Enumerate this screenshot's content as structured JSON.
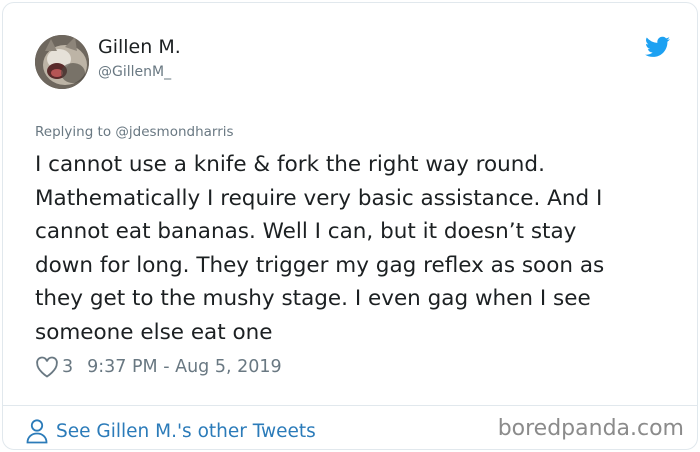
{
  "author": {
    "display_name": "Gillen M.",
    "handle": "@GillenM_",
    "avatar_icon": "cat-avatar"
  },
  "reply_to": "Replying to @jdesmondharris",
  "tweet": {
    "lines": [
      "I cannot use a knife & fork the right way round.",
      "Mathematically I require very basic assistance. And I",
      "cannot eat bananas. Well I can, but it doesn’t stay",
      "down for long. They trigger my gag reflex as soon as",
      "they get to the mushy stage. I even gag when I see",
      "someone else eat one"
    ]
  },
  "meta": {
    "likes": "3",
    "timestamp": "9:37 PM - Aug 5, 2019"
  },
  "footer": {
    "other_tweets_label": "See Gillen M.'s other Tweets",
    "watermark": "boredpanda.com"
  },
  "colors": {
    "link_blue": "#2b7bb9",
    "twitter_blue": "#1da1f2",
    "muted_gray": "#697882",
    "text": "#1c2022",
    "border": "#e1e8ed"
  }
}
